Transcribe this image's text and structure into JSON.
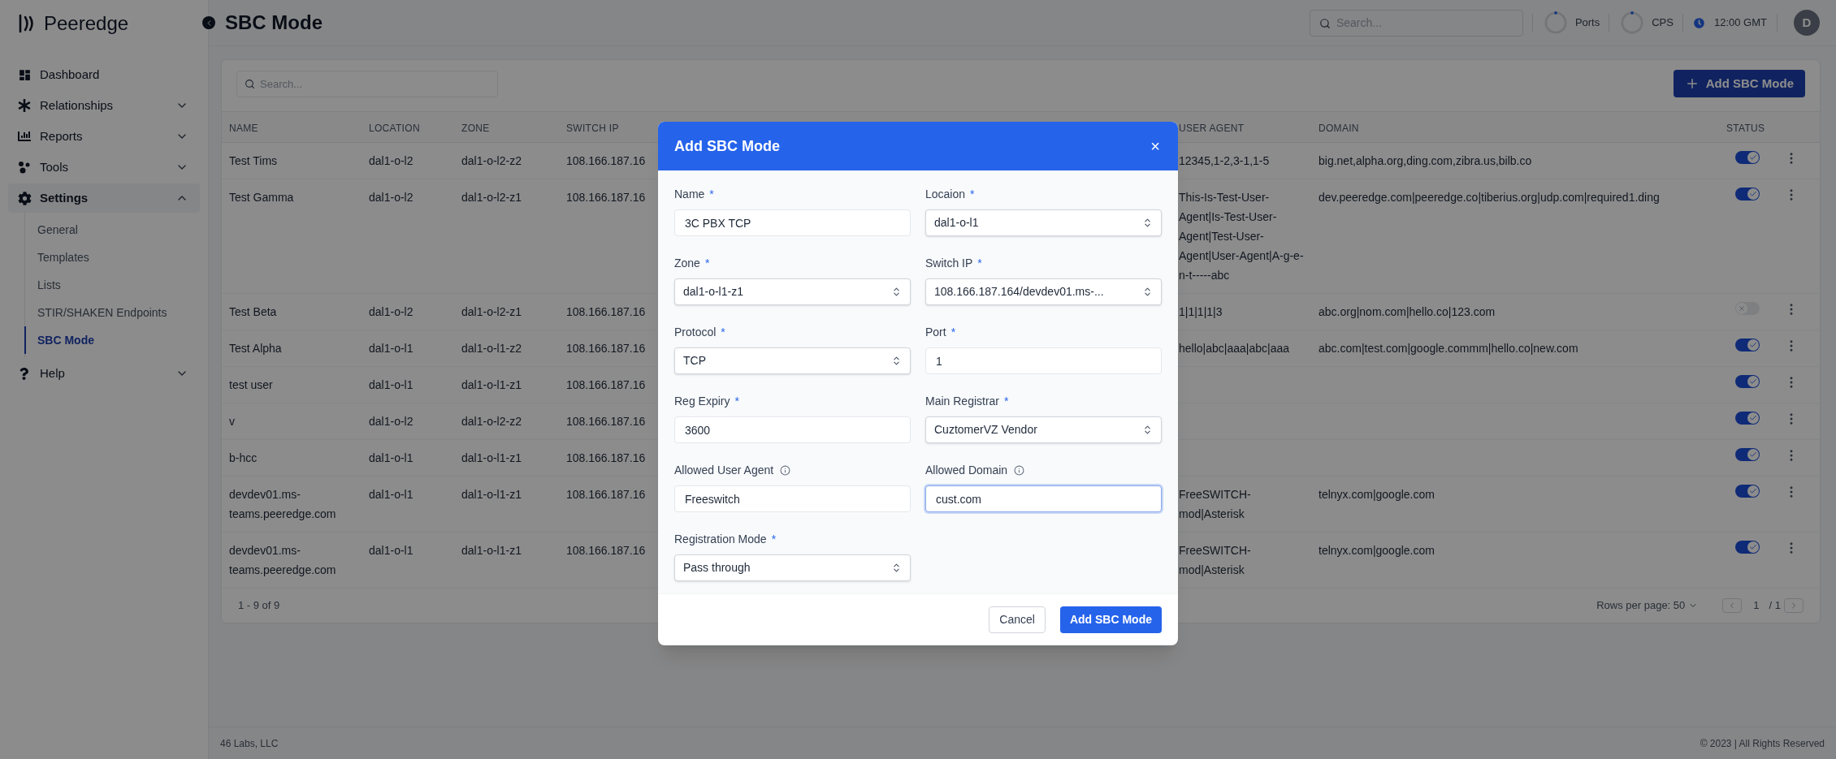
{
  "sidebar": {
    "logo": "Peeredge",
    "items": [
      {
        "label": "Dashboard",
        "selected": false
      },
      {
        "label": "Relationships",
        "selected": false,
        "expanded": false
      },
      {
        "label": "Reports",
        "selected": false,
        "expanded": false
      },
      {
        "label": "Tools",
        "selected": false,
        "expanded": false
      },
      {
        "label": "Settings",
        "selected": true,
        "expanded": true,
        "children": [
          {
            "label": "General",
            "selected": false
          },
          {
            "label": "Templates",
            "selected": false
          },
          {
            "label": "Lists",
            "selected": false
          },
          {
            "label": "STIR/SHAKEN Endpoints",
            "selected": false
          },
          {
            "label": "SBC Mode",
            "selected": true
          }
        ]
      },
      {
        "label": "Help",
        "selected": false,
        "expanded": false
      }
    ]
  },
  "header": {
    "title": "SBC Mode",
    "search": {
      "placeholder": "Search..."
    },
    "stats": [
      {
        "label": "Ports"
      },
      {
        "label": "CPS"
      }
    ],
    "time": "12:00 GMT",
    "avatar": "D"
  },
  "toolbar": {
    "search": {
      "placeholder": "Search..."
    },
    "add_button": "Add SBC Mode"
  },
  "table": {
    "columns": [
      "NAME",
      "LOCATION",
      "ZONE",
      "SWITCH IP",
      "USER AGENT",
      "DOMAIN",
      "STATUS"
    ],
    "rows": [
      {
        "name": "Test Tims",
        "location": "dal1-o-l2",
        "zone": "dal1-o-l2-z2",
        "switch_ip": "108.166.187.16",
        "user_agent": "12345,1-2,3-1,1-5",
        "domain": "big.net,alpha.org,ding.com,zibra.us,bilb.co",
        "on": true
      },
      {
        "name": "Test Gamma",
        "location": "dal1-o-l2",
        "zone": "dal1-o-l2-z1",
        "switch_ip": "108.166.187.16",
        "user_agent": "This-Is-Test-User-Agent|Is-Test-User-Agent|Test-User-Agent|User-Agent|A-g-e-n-t-----abc",
        "domain": "dev.peeredge.com|peeredge.co|tiberius.org|udp.com|required1.ding",
        "on": true
      },
      {
        "name": "Test Beta",
        "location": "dal1-o-l2",
        "zone": "dal1-o-l2-z1",
        "switch_ip": "108.166.187.16",
        "user_agent": "1|1|1|1|3",
        "domain": "abc.org|nom.com|hello.co|123.com",
        "on": false
      },
      {
        "name": "Test Alpha",
        "location": "dal1-o-l1",
        "zone": "dal1-o-l1-z2",
        "switch_ip": "108.166.187.16",
        "user_agent": "hello|abc|aaa|abc|aaa",
        "domain": "abc.com|test.com|google.commm|hello.co|new.com",
        "on": true
      },
      {
        "name": "test user",
        "location": "dal1-o-l1",
        "zone": "dal1-o-l1-z1",
        "switch_ip": "108.166.187.16",
        "on": true
      },
      {
        "name": "v",
        "location": "dal1-o-l2",
        "zone": "dal1-o-l2-z2",
        "switch_ip": "108.166.187.16",
        "on": true
      },
      {
        "name": "b-hcc",
        "location": "dal1-o-l1",
        "zone": "dal1-o-l1-z1",
        "switch_ip": "108.166.187.16",
        "on": true
      },
      {
        "name": "devdev01.ms-teams.peeredge.com",
        "location": "dal1-o-l1",
        "zone": "dal1-o-l1-z1",
        "switch_ip": "108.166.187.16",
        "user_agent": "FreeSWITCH-mod|Asterisk",
        "domain": "telnyx.com|google.com",
        "on": true
      },
      {
        "name": "devdev01.ms-teams.peeredge.com",
        "location": "dal1-o-l1",
        "zone": "dal1-o-l1-z1",
        "switch_ip": "108.166.187.16",
        "user_agent": "FreeSWITCH-mod|Asterisk",
        "domain": "telnyx.com|google.com",
        "on": true
      }
    ],
    "range": "1 - 9 of 9",
    "rows_per_page": "Rows per page: 50",
    "page": "1",
    "page_total": "/ 1"
  },
  "footer": {
    "left": "46 Labs, LLC",
    "right": "© 2023 | All Rights Reserved"
  },
  "dialog": {
    "title": "Add SBC Mode",
    "close": "×",
    "fields": [
      {
        "label": "Name",
        "marker": "*",
        "kind": "text",
        "value": "3C PBX TCP",
        "focused": false
      },
      {
        "label": "Locaion",
        "marker": "*",
        "kind": "select",
        "value": "dal1-o-l1",
        "focused": false
      },
      {
        "label": "Zone",
        "marker": "*",
        "kind": "select",
        "value": "dal1-o-l1-z1",
        "focused": false
      },
      {
        "label": "Switch IP",
        "marker": "*",
        "kind": "select",
        "value": "108.166.187.164/devdev01.ms-...",
        "focused": false
      },
      {
        "label": "Protocol",
        "marker": "*",
        "kind": "select",
        "value": "TCP",
        "focused": false
      },
      {
        "label": "Port",
        "marker": "*",
        "kind": "text",
        "value": "1",
        "focused": false
      },
      {
        "label": "Reg Expiry",
        "marker": "*",
        "kind": "text",
        "value": "3600",
        "focused": false
      },
      {
        "label": "Main Registrar",
        "marker": "*",
        "kind": "select",
        "value": "CuztomerVZ Vendor",
        "focused": false
      },
      {
        "label": "Allowed User Agent",
        "info": true,
        "kind": "text",
        "value": "Freeswitch",
        "focused": false
      },
      {
        "label": "Allowed Domain",
        "info": true,
        "kind": "text",
        "value": "cust.com",
        "focused": true
      },
      {
        "label": "Registration Mode",
        "marker": "*",
        "kind": "select",
        "value": "Pass through",
        "focused": false
      }
    ],
    "buttons": {
      "cancel": "Cancel",
      "submit": "Add SBC Mode"
    }
  }
}
